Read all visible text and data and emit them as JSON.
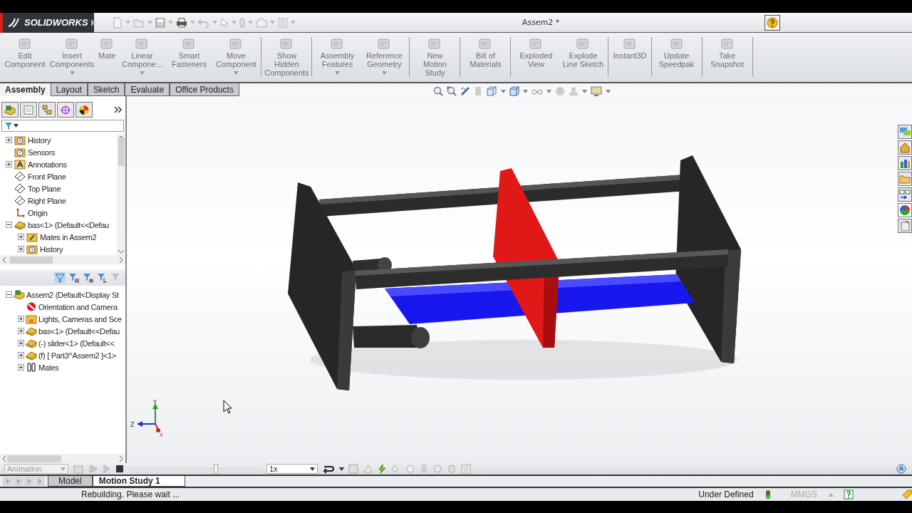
{
  "window": {
    "app_name": "SOLIDWORKS",
    "title": "Assem2 *"
  },
  "command_groups": [
    {
      "buttons": [
        {
          "label": "Edit Component",
          "has_menu": false
        },
        {
          "label": "Insert Components",
          "has_menu": true
        },
        {
          "label": "Mate",
          "has_menu": false
        },
        {
          "label": "Linear Compone...",
          "has_menu": true
        },
        {
          "label": "Smart Fasteners",
          "has_menu": false
        },
        {
          "label": "Move Component",
          "has_menu": true
        }
      ]
    },
    {
      "buttons": [
        {
          "label": "Show Hidden Components",
          "has_menu": false
        }
      ]
    },
    {
      "buttons": [
        {
          "label": "Assembly Features",
          "has_menu": true
        },
        {
          "label": "Reference Geometry",
          "has_menu": true
        }
      ]
    },
    {
      "buttons": [
        {
          "label": "New Motion Study",
          "has_menu": false
        }
      ]
    },
    {
      "buttons": [
        {
          "label": "Bill of Materials",
          "has_menu": false
        }
      ]
    },
    {
      "buttons": [
        {
          "label": "Exploded View",
          "has_menu": false
        },
        {
          "label": "Explode Line Sketch",
          "has_menu": false
        }
      ]
    },
    {
      "buttons": [
        {
          "label": "Instant3D",
          "has_menu": false
        }
      ]
    },
    {
      "buttons": [
        {
          "label": "Update Speedpak",
          "has_menu": false
        }
      ]
    },
    {
      "buttons": [
        {
          "label": "Take Snapshot",
          "has_menu": false
        }
      ]
    }
  ],
  "tabs": [
    {
      "label": "Assembly",
      "selected": true
    },
    {
      "label": "Layout",
      "selected": false
    },
    {
      "label": "Sketch",
      "selected": false
    },
    {
      "label": "Evaluate",
      "selected": false
    },
    {
      "label": "Office Products",
      "selected": false
    }
  ],
  "feature_tree": {
    "items": [
      {
        "label": "History",
        "kind": "history",
        "expanded": false
      },
      {
        "label": "Sensors",
        "kind": "sensors"
      },
      {
        "label": "Annotations",
        "kind": "annotations",
        "expanded": false
      },
      {
        "label": "Front Plane",
        "kind": "plane"
      },
      {
        "label": "Top Plane",
        "kind": "plane"
      },
      {
        "label": "Right Plane",
        "kind": "plane"
      },
      {
        "label": "Origin",
        "kind": "origin"
      },
      {
        "label": "bas<1> (Default<<Defau",
        "kind": "part",
        "expanded": true,
        "children": [
          {
            "label": "Mates in Assem2",
            "kind": "mates_folder",
            "expanded": false
          },
          {
            "label": "History",
            "kind": "history",
            "expanded": false
          }
        ]
      }
    ]
  },
  "motion_tree": {
    "items": [
      {
        "label": "Assem2 (Default<Display St",
        "kind": "assembly",
        "expanded": true,
        "children": [
          {
            "label": "Orientation and Camera",
            "kind": "camera"
          },
          {
            "label": "Lights, Cameras and Sce",
            "kind": "lights",
            "expanded": false
          },
          {
            "label": "bas<1> (Default<<Defau",
            "kind": "part",
            "expanded": false
          },
          {
            "label": "(-) slider<1> (Default<<",
            "kind": "part",
            "expanded": false
          },
          {
            "label": "(f) [ Part3^Assem2 ]<1>",
            "kind": "part",
            "expanded": false
          },
          {
            "label": "Mates",
            "kind": "mates",
            "expanded": false
          }
        ]
      }
    ]
  },
  "viewport": {
    "triad_axes": [
      "Y",
      "Z",
      "X"
    ]
  },
  "task_pane": {
    "tabs": [
      {
        "selected": false
      },
      {
        "selected": false
      },
      {
        "selected": false
      },
      {
        "selected": false
      },
      {
        "selected": false
      },
      {
        "selected": true
      },
      {
        "selected": false
      }
    ]
  },
  "motion_manager": {
    "study_type": "Animation",
    "playback_speed": "1x",
    "timeline": {
      "level": 0.7
    }
  },
  "bottom_tabs": [
    {
      "label": "Model",
      "selected": false
    },
    {
      "label": "Motion Study 1",
      "selected": true
    }
  ],
  "status_bar": {
    "message": "Rebuilding. Please wait ...",
    "definition": "Under Defined",
    "units": "MMGS"
  }
}
